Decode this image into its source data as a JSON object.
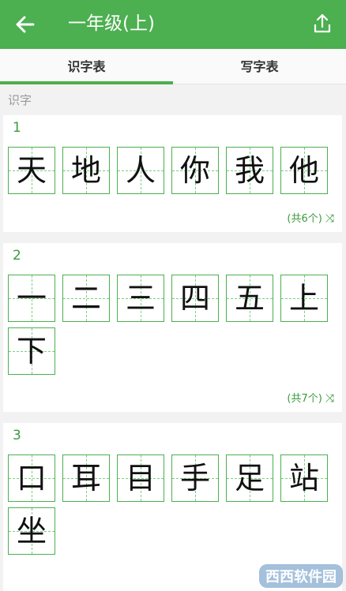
{
  "header": {
    "title": "一年级(上)",
    "back_icon": "arrow-left-icon",
    "share_icon": "share-icon"
  },
  "tabs": [
    {
      "label": "识字表",
      "active": true
    },
    {
      "label": "写字表",
      "active": false
    }
  ],
  "section_label": "识字",
  "groups": [
    {
      "number": "1",
      "chars": [
        "天",
        "地",
        "人",
        "你",
        "我",
        "他"
      ],
      "count_text": "(共6个)"
    },
    {
      "number": "2",
      "chars": [
        "一",
        "二",
        "三",
        "四",
        "五",
        "上",
        "下"
      ],
      "count_text": "(共7个)"
    },
    {
      "number": "3",
      "chars": [
        "口",
        "耳",
        "目",
        "手",
        "足",
        "站",
        "坐"
      ],
      "count_text": ""
    }
  ],
  "watermark": "西西软件园",
  "colors": {
    "accent": "#4caf50",
    "number": "#3a9b3e"
  }
}
